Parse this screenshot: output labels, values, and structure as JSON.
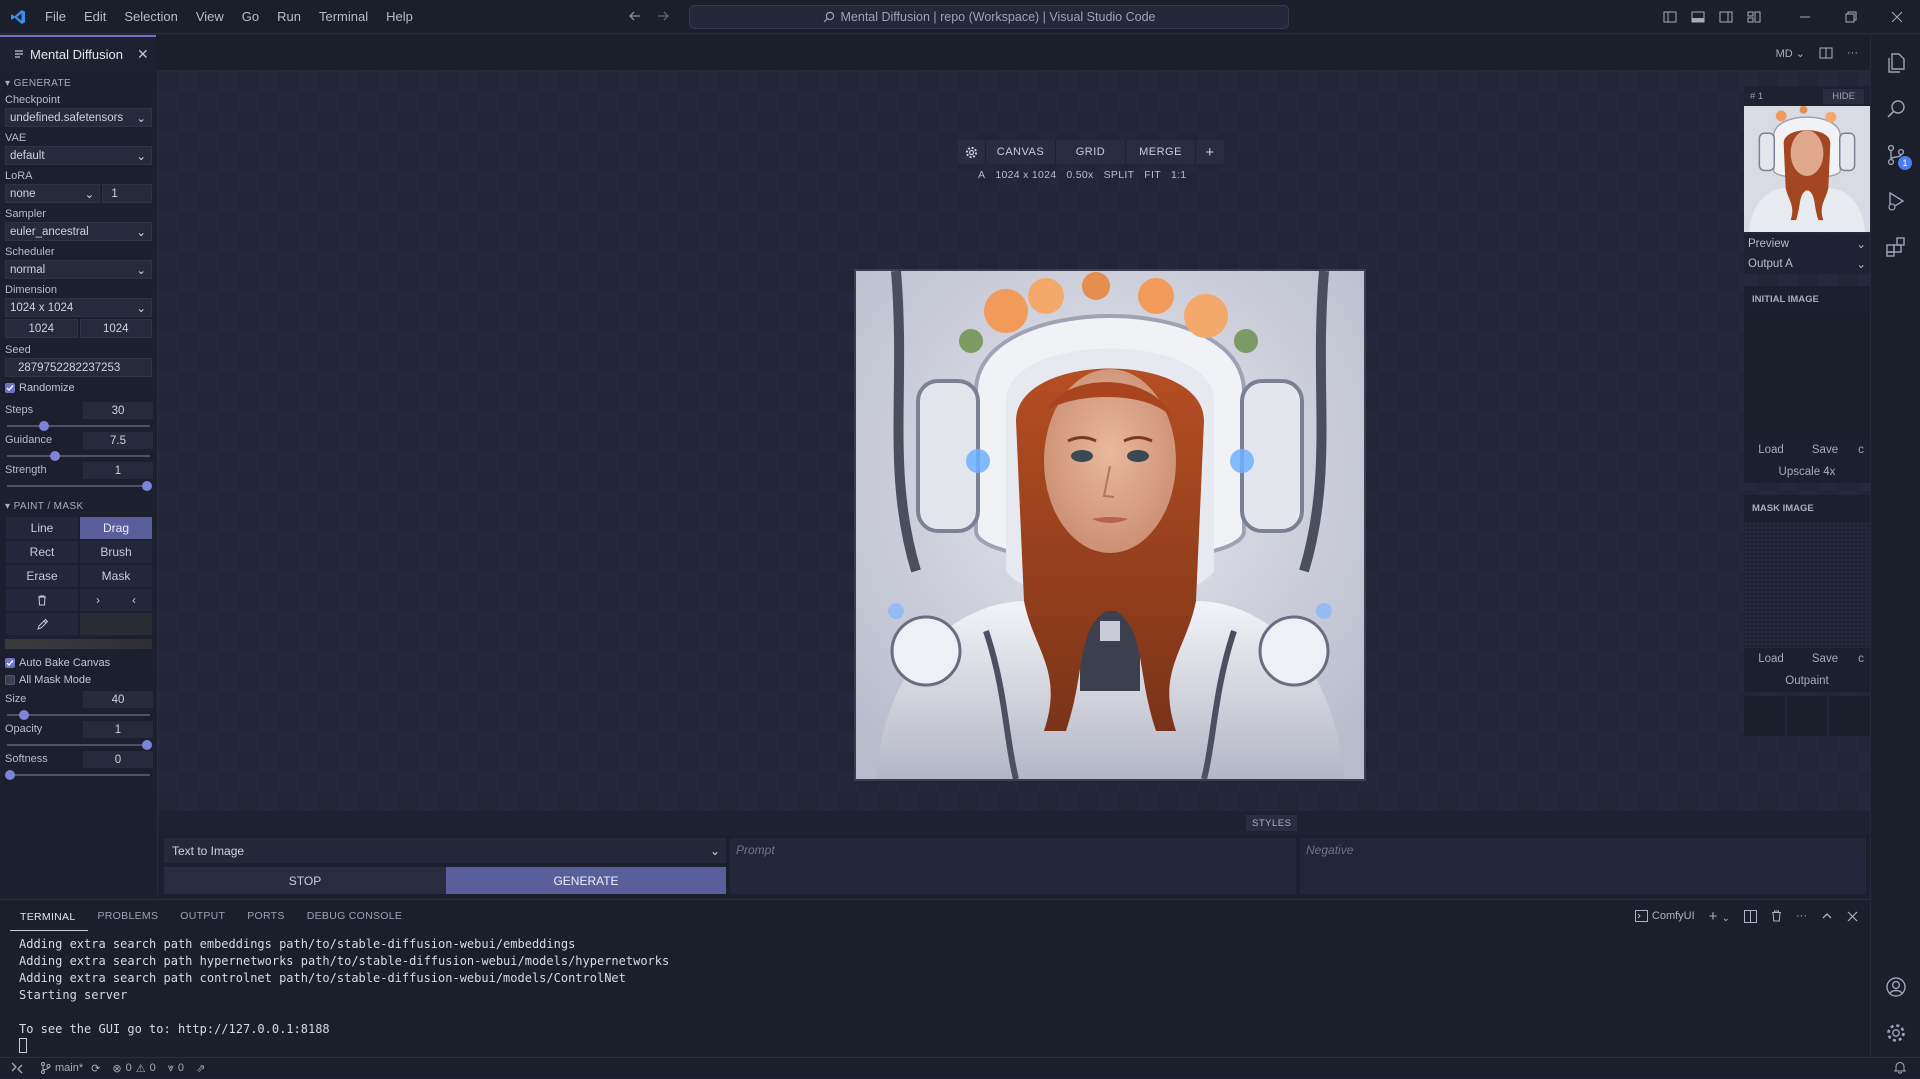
{
  "titlebar": {
    "menu": [
      "File",
      "Edit",
      "Selection",
      "View",
      "Go",
      "Run",
      "Terminal",
      "Help"
    ],
    "command_center": "Mental Diffusion | repo (Workspace) | Visual Studio Code"
  },
  "editor": {
    "tab_label": "Mental Diffusion",
    "tab_close": "✕",
    "mode_label": "MD"
  },
  "left": {
    "generate_title": "GENERATE",
    "checkpoint_label": "Checkpoint",
    "checkpoint_value": "undefined.safetensors",
    "vae_label": "VAE",
    "vae_value": "default",
    "lora_label": "LoRA",
    "lora_value": "none",
    "lora_weight": "1",
    "sampler_label": "Sampler",
    "sampler_value": "euler_ancestral",
    "scheduler_label": "Scheduler",
    "scheduler_value": "normal",
    "dimension_label": "Dimension",
    "dimension_value": "1024 x 1024",
    "width": "1024",
    "height": "1024",
    "seed_label": "Seed",
    "seed_value": "2879752282237253",
    "randomize_label": "Randomize",
    "steps": {
      "label": "Steps",
      "value": "30",
      "fraction": 0.25
    },
    "guidance": {
      "label": "Guidance",
      "value": "7.5",
      "fraction": 0.33
    },
    "strength": {
      "label": "Strength",
      "value": "1",
      "fraction": 1.0
    },
    "paint_title": "PAINT / MASK",
    "tools": [
      "Line",
      "Drag",
      "Rect",
      "Brush",
      "Erase",
      "Mask"
    ],
    "active_tool": "Drag",
    "auto_bake_label": "Auto Bake Canvas",
    "all_mask_label": "All Mask Mode",
    "size": {
      "label": "Size",
      "value": "40",
      "fraction": 0.1
    },
    "opacity": {
      "label": "Opacity",
      "value": "1",
      "fraction": 1.0
    },
    "softness": {
      "label": "Softness",
      "value": "0",
      "fraction": 0.0
    }
  },
  "canvas": {
    "toolbar": [
      "CANVAS",
      "GRID",
      "MERGE"
    ],
    "info": [
      "A",
      "1024 x 1024",
      "0.50x",
      "SPLIT",
      "FIT",
      "1:1"
    ],
    "styles_label": "STYLES"
  },
  "right": {
    "index_label": "# 1",
    "hide_label": "HIDE",
    "preview_value": "Preview",
    "output_value": "Output A",
    "initial_title": "INITIAL IMAGE",
    "load_label": "Load",
    "save_label": "Save",
    "clear_label": "c",
    "upscale_label": "Upscale 4x",
    "mask_title": "MASK IMAGE",
    "outpaint_label": "Outpaint"
  },
  "prompt_bar": {
    "mode_value": "Text to Image",
    "stop_label": "STOP",
    "generate_label": "GENERATE",
    "prompt_placeholder": "Prompt",
    "negative_placeholder": "Negative"
  },
  "panel": {
    "tabs": [
      "TERMINAL",
      "PROBLEMS",
      "OUTPUT",
      "PORTS",
      "DEBUG CONSOLE"
    ],
    "terminal_name": "ComfyUI",
    "lines": [
      "Adding extra search path embeddings path/to/stable-diffusion-webui/embeddings",
      "Adding extra search path hypernetworks path/to/stable-diffusion-webui/models/hypernetworks",
      "Adding extra search path controlnet path/to/stable-diffusion-webui/models/ControlNet",
      "Starting server",
      "",
      "To see the GUI go to: http://127.0.0.1:8188"
    ]
  },
  "status": {
    "branch": "main*",
    "errors": "0",
    "warnings": "0",
    "ports": "0"
  },
  "activity": {
    "scm_badge": "1"
  },
  "colors": {
    "accent": "#6c74c8",
    "button_active": "#5a5f9b",
    "background": "#1e2130"
  }
}
